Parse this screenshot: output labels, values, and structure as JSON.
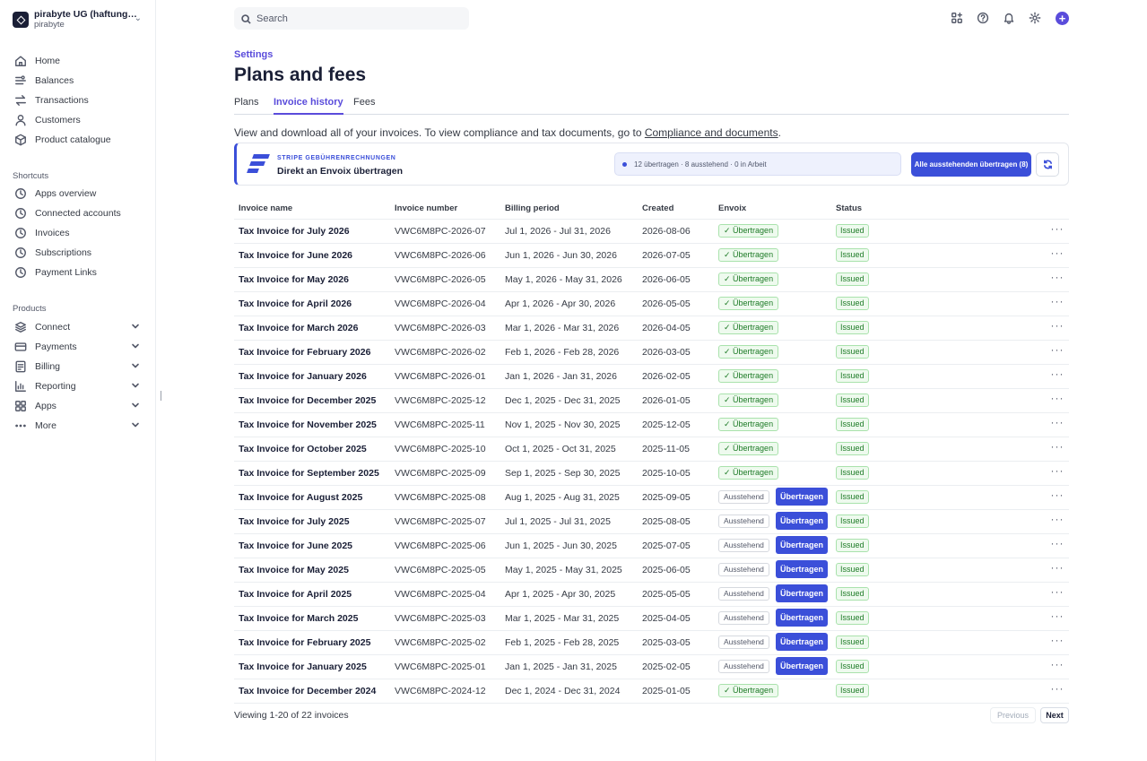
{
  "account": {
    "name": "pirabyte UG (haftungs...",
    "sub": "pirabyte"
  },
  "nav": {
    "main": [
      {
        "label": "Home",
        "icon": "home-icon"
      },
      {
        "label": "Balances",
        "icon": "balances-icon"
      },
      {
        "label": "Transactions",
        "icon": "transactions-icon"
      },
      {
        "label": "Customers",
        "icon": "customers-icon"
      },
      {
        "label": "Product catalogue",
        "icon": "product-catalogue-icon"
      }
    ],
    "shortcuts_heading": "Shortcuts",
    "shortcuts": [
      {
        "label": "Apps overview"
      },
      {
        "label": "Connected accounts"
      },
      {
        "label": "Invoices"
      },
      {
        "label": "Subscriptions"
      },
      {
        "label": "Payment Links"
      }
    ],
    "products_heading": "Products",
    "products": [
      {
        "label": "Connect"
      },
      {
        "label": "Payments"
      },
      {
        "label": "Billing"
      },
      {
        "label": "Reporting"
      },
      {
        "label": "Apps"
      },
      {
        "label": "More"
      }
    ]
  },
  "search": {
    "placeholder": "Search"
  },
  "header": {
    "breadcrumb": "Settings",
    "title": "Plans and fees",
    "tabs": [
      {
        "label": "Plans",
        "active": false
      },
      {
        "label": "Invoice history",
        "active": true
      },
      {
        "label": "Fees",
        "active": false
      }
    ]
  },
  "description": {
    "text": "View and download all of your invoices. To view compliance and tax documents, go to ",
    "link": "Compliance and documents",
    "end": "."
  },
  "envoix": {
    "eyebrow": "STRIPE GEBÜHRENRECHNUNGEN",
    "title": "Direkt an Envoix übertragen",
    "status": "12 übertragen · 8 ausstehend · 0 in Arbeit",
    "button": "Alle ausstehenden übertragen (8)",
    "accent": "#3b4fd9"
  },
  "table": {
    "columns": [
      "Invoice name",
      "Invoice number",
      "Billing period",
      "Created",
      "Envoix",
      "Status"
    ],
    "labels": {
      "done": "✓ Übertragen",
      "pending": "Ausstehend",
      "transfer": "Übertragen",
      "issued": "Issued",
      "more": "···"
    },
    "rows": [
      {
        "name": "Tax Invoice for July 2026",
        "number": "VWC6M8PC-2026-07",
        "period": "Jul 1, 2026 - Jul 31, 2026",
        "created": "2026-08-06",
        "envoix": "done",
        "status": "Issued"
      },
      {
        "name": "Tax Invoice for June 2026",
        "number": "VWC6M8PC-2026-06",
        "period": "Jun 1, 2026 - Jun 30, 2026",
        "created": "2026-07-05",
        "envoix": "done",
        "status": "Issued"
      },
      {
        "name": "Tax Invoice for May 2026",
        "number": "VWC6M8PC-2026-05",
        "period": "May 1, 2026 - May 31, 2026",
        "created": "2026-06-05",
        "envoix": "done",
        "status": "Issued"
      },
      {
        "name": "Tax Invoice for April 2026",
        "number": "VWC6M8PC-2026-04",
        "period": "Apr 1, 2026 - Apr 30, 2026",
        "created": "2026-05-05",
        "envoix": "done",
        "status": "Issued"
      },
      {
        "name": "Tax Invoice for March 2026",
        "number": "VWC6M8PC-2026-03",
        "period": "Mar 1, 2026 - Mar 31, 2026",
        "created": "2026-04-05",
        "envoix": "done",
        "status": "Issued"
      },
      {
        "name": "Tax Invoice for February 2026",
        "number": "VWC6M8PC-2026-02",
        "period": "Feb 1, 2026 - Feb 28, 2026",
        "created": "2026-03-05",
        "envoix": "done",
        "status": "Issued"
      },
      {
        "name": "Tax Invoice for January 2026",
        "number": "VWC6M8PC-2026-01",
        "period": "Jan 1, 2026 - Jan 31, 2026",
        "created": "2026-02-05",
        "envoix": "done",
        "status": "Issued"
      },
      {
        "name": "Tax Invoice for December 2025",
        "number": "VWC6M8PC-2025-12",
        "period": "Dec 1, 2025 - Dec 31, 2025",
        "created": "2026-01-05",
        "envoix": "done",
        "status": "Issued"
      },
      {
        "name": "Tax Invoice for November 2025",
        "number": "VWC6M8PC-2025-11",
        "period": "Nov 1, 2025 - Nov 30, 2025",
        "created": "2025-12-05",
        "envoix": "done",
        "status": "Issued"
      },
      {
        "name": "Tax Invoice for October 2025",
        "number": "VWC6M8PC-2025-10",
        "period": "Oct 1, 2025 - Oct 31, 2025",
        "created": "2025-11-05",
        "envoix": "done",
        "status": "Issued"
      },
      {
        "name": "Tax Invoice for September 2025",
        "number": "VWC6M8PC-2025-09",
        "period": "Sep 1, 2025 - Sep 30, 2025",
        "created": "2025-10-05",
        "envoix": "done",
        "status": "Issued"
      },
      {
        "name": "Tax Invoice for August 2025",
        "number": "VWC6M8PC-2025-08",
        "period": "Aug 1, 2025 - Aug 31, 2025",
        "created": "2025-09-05",
        "envoix": "pending",
        "status": "Issued"
      },
      {
        "name": "Tax Invoice for July 2025",
        "number": "VWC6M8PC-2025-07",
        "period": "Jul 1, 2025 - Jul 31, 2025",
        "created": "2025-08-05",
        "envoix": "pending",
        "status": "Issued"
      },
      {
        "name": "Tax Invoice for June 2025",
        "number": "VWC6M8PC-2025-06",
        "period": "Jun 1, 2025 - Jun 30, 2025",
        "created": "2025-07-05",
        "envoix": "pending",
        "status": "Issued"
      },
      {
        "name": "Tax Invoice for May 2025",
        "number": "VWC6M8PC-2025-05",
        "period": "May 1, 2025 - May 31, 2025",
        "created": "2025-06-05",
        "envoix": "pending",
        "status": "Issued"
      },
      {
        "name": "Tax Invoice for April 2025",
        "number": "VWC6M8PC-2025-04",
        "period": "Apr 1, 2025 - Apr 30, 2025",
        "created": "2025-05-05",
        "envoix": "pending",
        "status": "Issued"
      },
      {
        "name": "Tax Invoice for March 2025",
        "number": "VWC6M8PC-2025-03",
        "period": "Mar 1, 2025 - Mar 31, 2025",
        "created": "2025-04-05",
        "envoix": "pending",
        "status": "Issued"
      },
      {
        "name": "Tax Invoice for February 2025",
        "number": "VWC6M8PC-2025-02",
        "period": "Feb 1, 2025 - Feb 28, 2025",
        "created": "2025-03-05",
        "envoix": "pending",
        "status": "Issued"
      },
      {
        "name": "Tax Invoice for January 2025",
        "number": "VWC6M8PC-2025-01",
        "period": "Jan 1, 2025 - Jan 31, 2025",
        "created": "2025-02-05",
        "envoix": "pending",
        "status": "Issued"
      },
      {
        "name": "Tax Invoice for December 2024",
        "number": "VWC6M8PC-2024-12",
        "period": "Dec 1, 2024 - Dec 31, 2024",
        "created": "2025-01-05",
        "envoix": "done",
        "status": "Issued"
      }
    ]
  },
  "pagination": {
    "summary": "Viewing 1-20 of 22 invoices",
    "previous": "Previous",
    "next": "Next"
  },
  "colors": {
    "brand_purple": "#5a4cdb",
    "envoix_blue": "#3b4fd9",
    "success_green": "#1e7b27"
  }
}
